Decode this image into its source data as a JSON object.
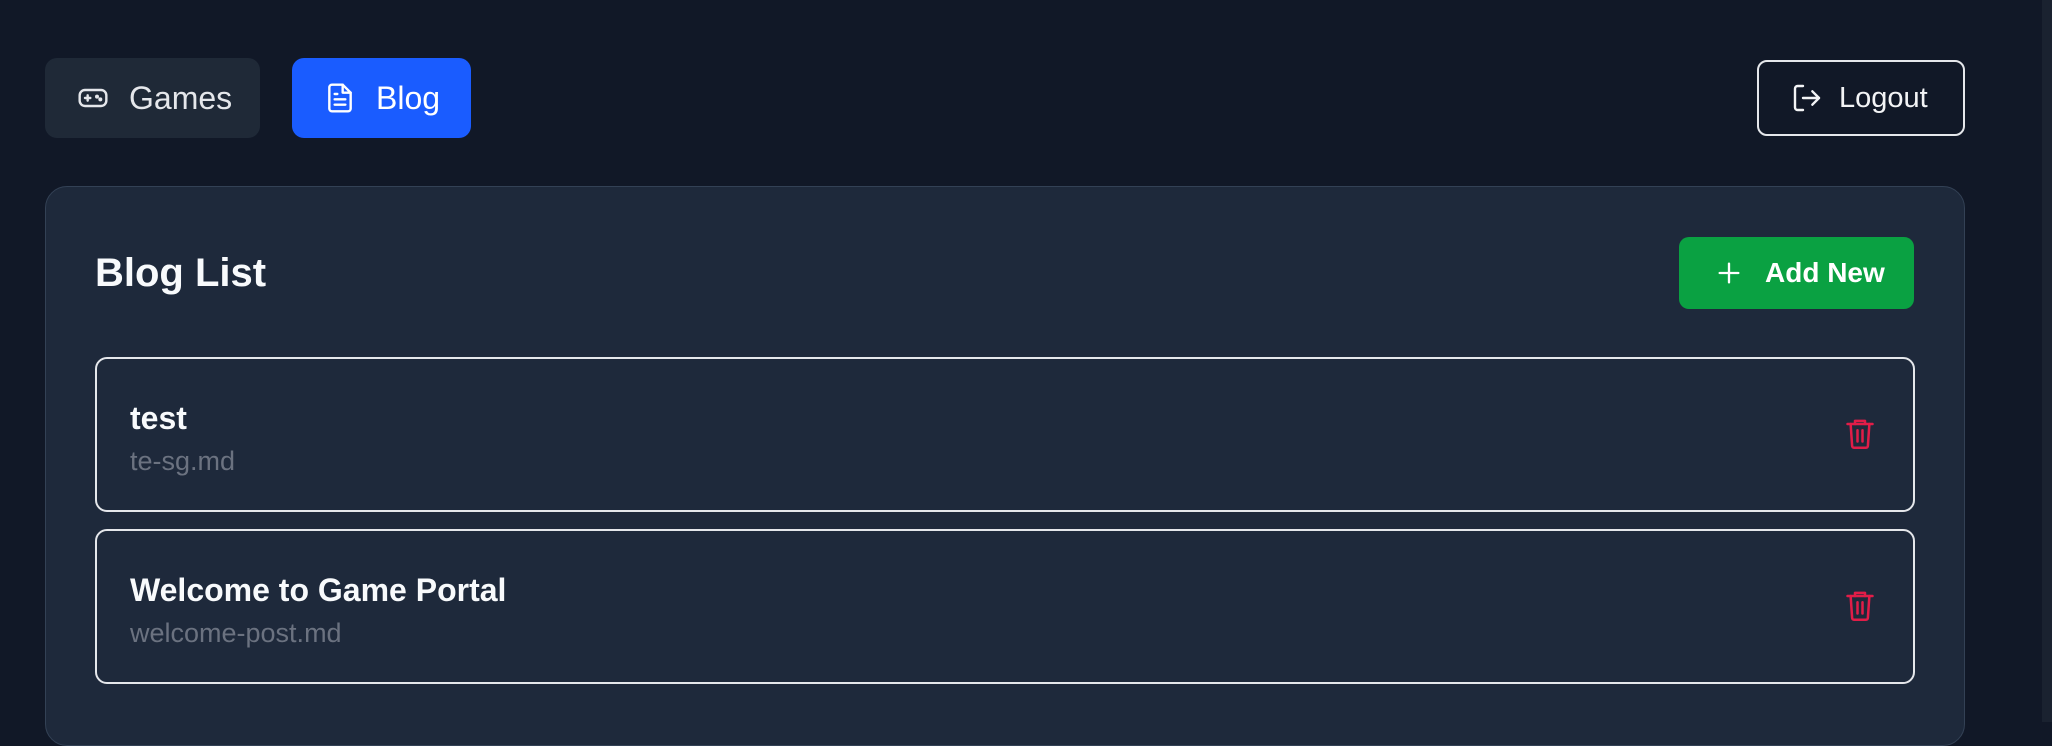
{
  "nav": {
    "games_label": "Games",
    "blog_label": "Blog",
    "logout_label": "Logout",
    "icons": {
      "games": "gamepad-icon",
      "blog": "document-icon",
      "logout": "logout-icon"
    }
  },
  "panel": {
    "title": "Blog List",
    "add_label": "Add New",
    "add_icon": "plus-icon",
    "posts": [
      {
        "title": "test",
        "file": "te-sg.md",
        "delete_icon": "trash-icon"
      },
      {
        "title": "Welcome to Game Portal",
        "file": "welcome-post.md",
        "delete_icon": "trash-icon"
      }
    ]
  },
  "colors": {
    "background": "#111827",
    "panel": "#1e293b",
    "active_tab": "#1a5cff",
    "add_button": "#0aa142",
    "delete": "#e11d48"
  }
}
